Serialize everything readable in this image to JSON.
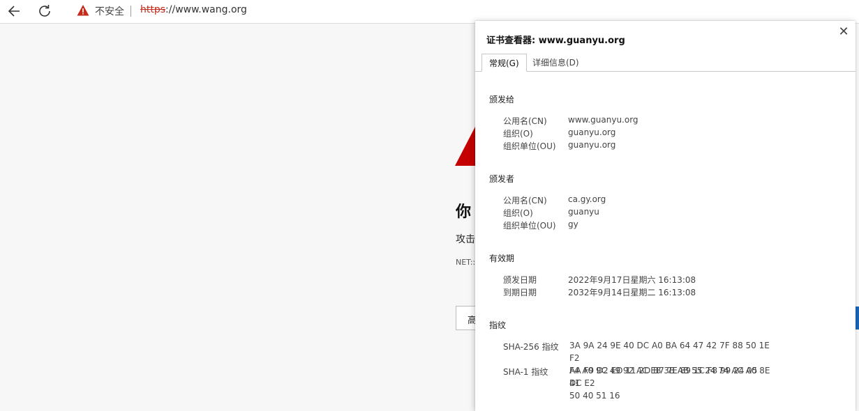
{
  "browser": {
    "insecure_label": "不安全",
    "url_scheme": "https",
    "url_rest": "://www.wang.org"
  },
  "error_page": {
    "heading_partial": "你",
    "text_partial": "攻击",
    "code_partial": "NET::",
    "button_partial": "高"
  },
  "cert_viewer": {
    "title": "证书查看器: www.guanyu.org",
    "tabs": [
      "常规(G)",
      "详细信息(D)"
    ],
    "issued_to": {
      "title": "颁发给",
      "rows": [
        {
          "label": "公用名(CN)",
          "value": "www.guanyu.org"
        },
        {
          "label": "组织(O)",
          "value": "guanyu.org"
        },
        {
          "label": "组织单位(OU)",
          "value": "guanyu.org"
        }
      ]
    },
    "issued_by": {
      "title": "颁发者",
      "rows": [
        {
          "label": "公用名(CN)",
          "value": "ca.gy.org"
        },
        {
          "label": "组织(O)",
          "value": "guanyu"
        },
        {
          "label": "组织单位(OU)",
          "value": "gy"
        }
      ]
    },
    "validity": {
      "title": "有效期",
      "rows": [
        {
          "label": "颁发日期",
          "value": "2022年9月17日星期六 16:13:08"
        },
        {
          "label": "到期日期",
          "value": "2032年9月14日星期二 16:13:08"
        }
      ]
    },
    "fingerprints": {
      "title": "指纹",
      "rows": [
        {
          "label": "SHA-256 指纹",
          "line1": "3A 9A 24 9E 40 DC A0 BA 64 47 42 7F 88 50 1E F2",
          "line2": "F4 A0 9C 49 92 AC E8 3B AB 55 24 74 AC A0 8E 41"
        },
        {
          "label": "SHA-1 指纹",
          "line1": "AA F9 D2 ED 11 2D B7 7E 89 1C F8 99 24 05 DC E2",
          "line2": "50 40 51 16"
        }
      ]
    }
  },
  "colors": {
    "warning": "#c42b1c",
    "accent": "#1a63b8"
  }
}
